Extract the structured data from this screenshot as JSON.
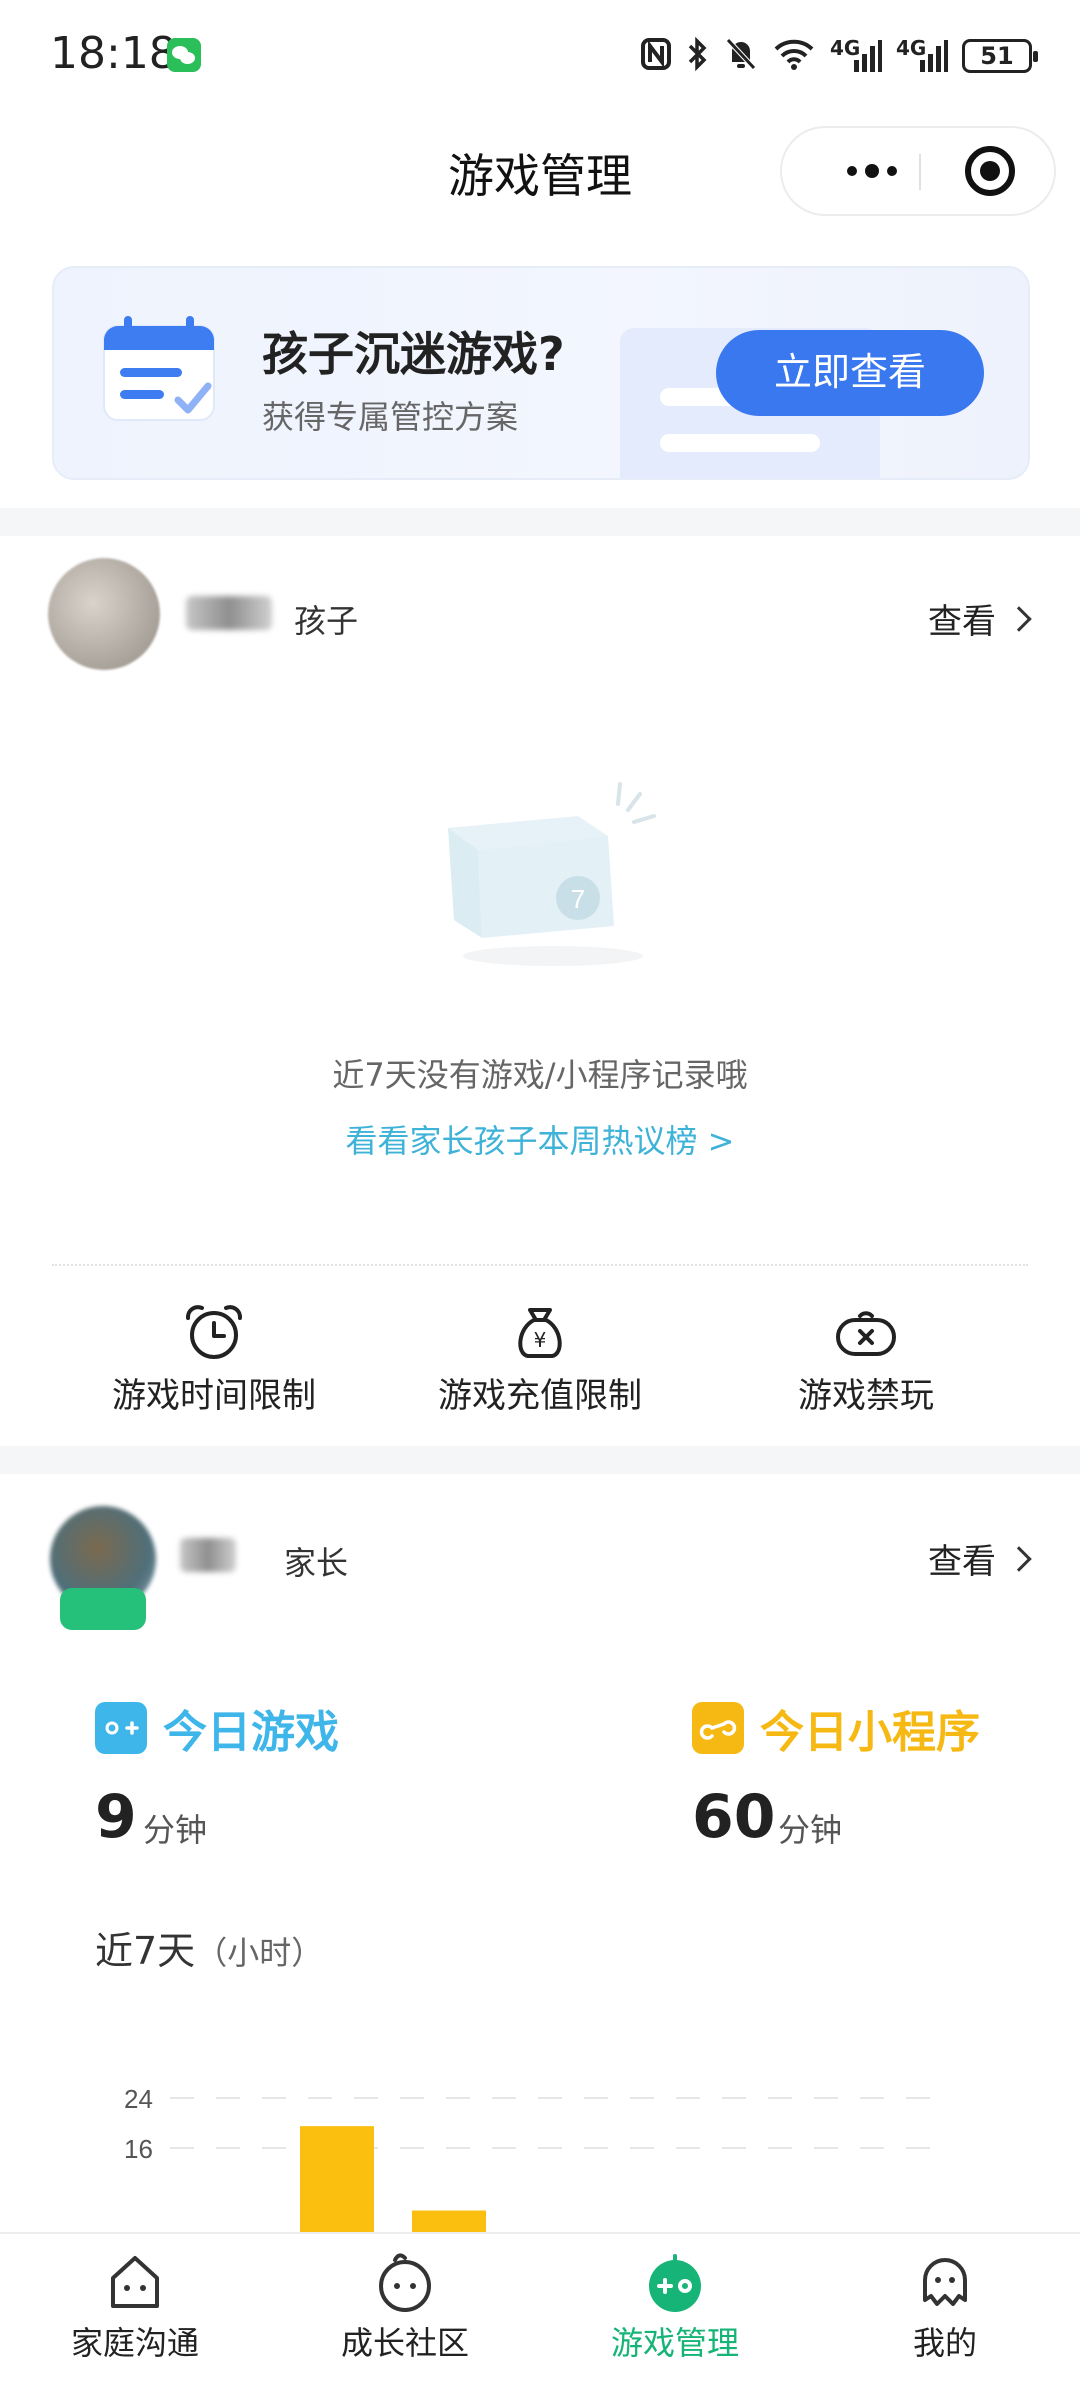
{
  "status_bar": {
    "time": "18:18",
    "network_1": "4G",
    "network_2": "4G",
    "battery": "51",
    "icons": [
      "wechat-icon",
      "nfc-icon",
      "bluetooth-icon",
      "mute-icon",
      "wifi-icon",
      "signal-icon",
      "signal-icon",
      "battery-icon"
    ]
  },
  "nav": {
    "title": "游戏管理"
  },
  "banner": {
    "title": "孩子沉迷游戏?",
    "subtitle": "获得专属管控方案",
    "button": "立即查看"
  },
  "child_card": {
    "role": "孩子",
    "view_label": "查看",
    "empty_text": "近7天没有游戏/小程序记录哦",
    "empty_link": "看看家长孩子本周热议榜 >",
    "features": [
      {
        "label": "游戏时间限制",
        "icon": "alarm-clock-icon"
      },
      {
        "label": "游戏充值限制",
        "icon": "money-bag-icon"
      },
      {
        "label": "游戏禁玩",
        "icon": "gamepad-ban-icon"
      }
    ]
  },
  "parent_card": {
    "role": "家长",
    "view_label": "查看",
    "today_games_label": "今日游戏",
    "today_games_value": "9",
    "today_games_unit": "分钟",
    "today_miniprog_label": "今日小程序",
    "today_miniprog_value": "60",
    "today_miniprog_unit": "分钟",
    "recent_title": "近7天",
    "recent_unit": "（小时）",
    "colors": {
      "games": "#3fb6ea",
      "miniprog": "#f6b812"
    }
  },
  "chart_data": {
    "type": "bar",
    "yticks": [
      "24",
      "16"
    ],
    "ylim": [
      0,
      28
    ],
    "values": [
      19.5,
      6
    ],
    "color": "#fbbf10",
    "grid": true
  },
  "tabbar": {
    "items": [
      {
        "label": "家庭沟通",
        "icon": "family-chat-icon"
      },
      {
        "label": "成长社区",
        "icon": "growth-community-icon"
      },
      {
        "label": "游戏管理",
        "icon": "game-manage-icon"
      },
      {
        "label": "我的",
        "icon": "profile-icon"
      }
    ],
    "active_color": "#16b477"
  }
}
